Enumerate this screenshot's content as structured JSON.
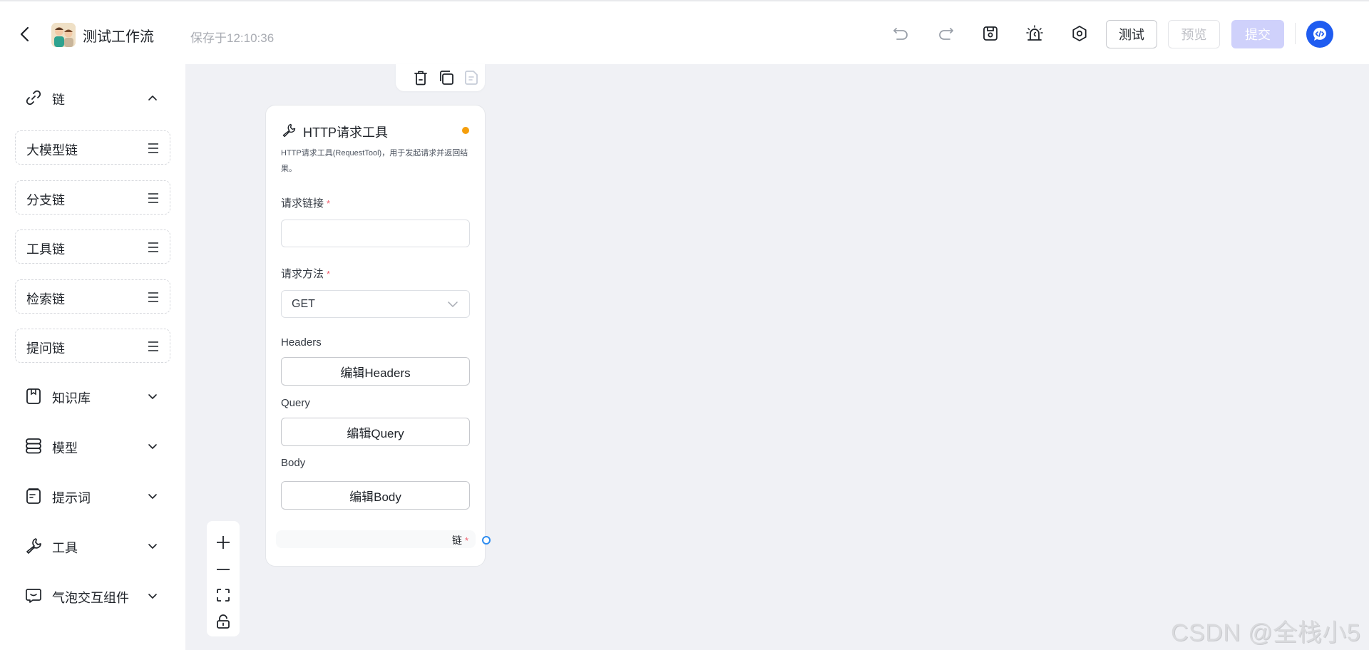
{
  "header": {
    "title": "测试工作流",
    "saved_status": "保存于12:10:36",
    "icons": [
      "back-icon",
      "undo-icon",
      "redo-icon",
      "save-icon",
      "alarm-icon",
      "settings-icon"
    ],
    "buttons": {
      "test": "测试",
      "preview": "预览",
      "submit": "提交"
    },
    "accent_color": "#1f5cf0",
    "submit_color": "#cfd1fb"
  },
  "sidebar": {
    "sections": [
      {
        "label": "链",
        "icon": "link-icon",
        "expanded": true
      },
      {
        "label": "知识库",
        "icon": "book-icon",
        "expanded": false
      },
      {
        "label": "模型",
        "icon": "database-icon",
        "expanded": false
      },
      {
        "label": "提示词",
        "icon": "prompt-doc-icon",
        "expanded": false
      },
      {
        "label": "工具",
        "icon": "wrench-icon",
        "expanded": false
      },
      {
        "label": "气泡交互组件",
        "icon": "chat-bubble-icon",
        "expanded": false
      }
    ],
    "chain_items": [
      {
        "label": "大模型链"
      },
      {
        "label": "分支链"
      },
      {
        "label": "工具链"
      },
      {
        "label": "检索链"
      },
      {
        "label": "提问链"
      }
    ]
  },
  "node_toolbar": {
    "icons": [
      "delete-icon",
      "copy-icon",
      "note-icon"
    ]
  },
  "node": {
    "title": "HTTP请求工具",
    "description": "HTTP请求工具(RequestTool)，用于发起请求并返回结果。",
    "status_color": "#f59e0b",
    "fields": {
      "url": {
        "label": "请求链接",
        "required_mark": "*",
        "value": "",
        "placeholder": ""
      },
      "method": {
        "label": "请求方法",
        "required_mark": "*",
        "value": "GET"
      },
      "headers": {
        "label": "Headers",
        "button": "编辑Headers"
      },
      "query": {
        "label": "Query",
        "button": "编辑Query"
      },
      "body": {
        "label": "Body",
        "button": "编辑Body"
      }
    },
    "output": {
      "label": "链",
      "required_mark": "*"
    }
  },
  "zoom_controls": [
    "zoom-in-icon",
    "zoom-out-icon",
    "fit-view-icon",
    "unlock-icon"
  ],
  "watermark": "CSDN @全栈小5"
}
